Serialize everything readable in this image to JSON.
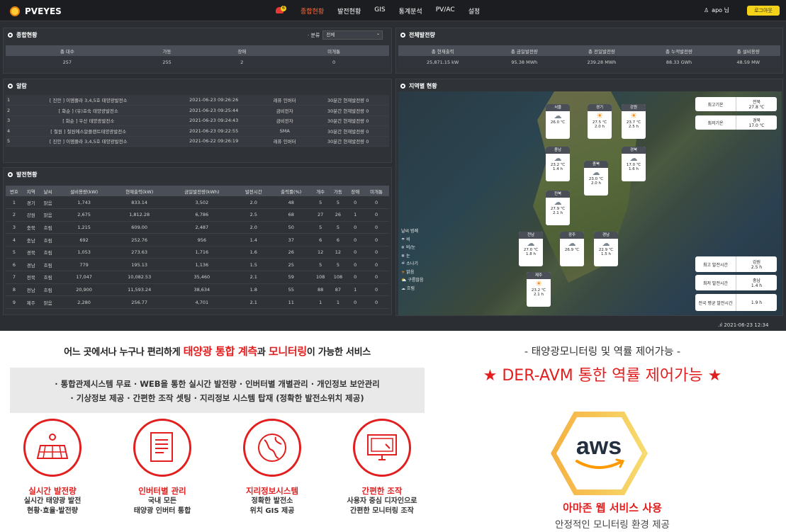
{
  "app": {
    "title": "PVEYES",
    "bell_count": "6"
  },
  "nav": {
    "items": [
      "종합현황",
      "발전현황",
      "GIS",
      "통계분석",
      "PV/AC",
      "설정"
    ],
    "active": 0
  },
  "user": {
    "name": "apo 님",
    "logout_label": "로그아웃"
  },
  "summary": {
    "title": "종합현황",
    "filter_label": "· 분류",
    "filter_value": "전체",
    "headers": [
      "총 대수",
      "가동",
      "장애",
      "미개통"
    ],
    "values": [
      "257",
      "255",
      "2",
      "0"
    ]
  },
  "overall": {
    "title": "전체발전량",
    "headers": [
      "총 현재출력",
      "총 금일발전량",
      "총 전일발전량",
      "총 누적발전량",
      "총 설비용량"
    ],
    "values": [
      "25,871.15 kW",
      "95.38 MWh",
      "239.28 MWh",
      "88.33 GWh",
      "48.59 MW"
    ]
  },
  "alarm": {
    "title": "알람",
    "rows": [
      [
        "1",
        "[ 진안 ] 이엠플라 3,4,5호 태양광발전소",
        "2021-06-23 09:26:26",
        "레퓨 인버터",
        "30분간 현재발전량 0"
      ],
      [
        "2",
        "[ 화순 ] (유)효숙 태양광발전소",
        "2021-06-23 09:25:44",
        "금비전자",
        "30분간 현재발전량 0"
      ],
      [
        "3",
        "[ 화순 ] 우산 태양광발전소",
        "2021-06-23 09:24:43",
        "금비전자",
        "30분간 현재발전량 0"
      ],
      [
        "4",
        "[ 철원 ] 철원에스알플랜트태양광발전소",
        "2021-06-23 09:22:55",
        "SMA",
        "30분간 현재발전량 0"
      ],
      [
        "5",
        "[ 진안 ] 이엠플라 3,4,5호 태양광발전소",
        "2021-06-22 09:26:19",
        "레퓨 인버터",
        "30분간 현재발전량 0"
      ]
    ]
  },
  "generation": {
    "title": "발전현황",
    "headers": [
      "번호",
      "지역",
      "날씨",
      "설비용량(kW)",
      "현재출력(kW)",
      "금일발전량(kWh)",
      "발전시간",
      "출력률(%)",
      "개수",
      "가동",
      "장애",
      "미개통"
    ],
    "rows": [
      [
        "1",
        "경기",
        "맑음",
        "1,743",
        "833.14",
        "3,502",
        "2.0",
        "48",
        "5",
        "5",
        "0",
        "0"
      ],
      [
        "2",
        "강원",
        "맑음",
        "2,675",
        "1,812.28",
        "6,786",
        "2.5",
        "68",
        "27",
        "26",
        "1",
        "0"
      ],
      [
        "3",
        "충북",
        "흐림",
        "1,215",
        "609.00",
        "2,487",
        "2.0",
        "50",
        "5",
        "5",
        "0",
        "0"
      ],
      [
        "4",
        "충남",
        "흐림",
        "692",
        "252.76",
        "956",
        "1.4",
        "37",
        "6",
        "6",
        "0",
        "0"
      ],
      [
        "5",
        "경북",
        "흐림",
        "1,053",
        "273.63",
        "1,716",
        "1.6",
        "26",
        "12",
        "12",
        "0",
        "0"
      ],
      [
        "6",
        "경남",
        "흐림",
        "779",
        "195.13",
        "1,136",
        "1.5",
        "25",
        "5",
        "5",
        "0",
        "0"
      ],
      [
        "7",
        "전북",
        "흐림",
        "17,047",
        "10,082.53",
        "35,460",
        "2.1",
        "59",
        "108",
        "108",
        "0",
        "0"
      ],
      [
        "8",
        "전남",
        "흐림",
        "20,900",
        "11,593.24",
        "38,634",
        "1.8",
        "55",
        "88",
        "87",
        "1",
        "0"
      ],
      [
        "9",
        "제주",
        "맑음",
        "2,280",
        "256.77",
        "4,701",
        "2.1",
        "11",
        "1",
        "1",
        "0",
        "0"
      ]
    ]
  },
  "region_map": {
    "title": "지역별 현황",
    "cards": [
      {
        "name": "서울",
        "temp": "26.0 ℃",
        "hours": "",
        "weather": "cloud"
      },
      {
        "name": "경기",
        "temp": "27.5 ℃",
        "hours": "2.0 h",
        "weather": "sun"
      },
      {
        "name": "강원",
        "temp": "23.7 ℃",
        "hours": "2.5 h",
        "weather": "sun"
      },
      {
        "name": "충남",
        "temp": "23.2 ℃",
        "hours": "1.4 h",
        "weather": "cloud"
      },
      {
        "name": "충북",
        "temp": "23.0 ℃",
        "hours": "2.0 h",
        "weather": "cloud"
      },
      {
        "name": "경북",
        "temp": "17.0 ℃",
        "hours": "1.6 h",
        "weather": "cloud"
      },
      {
        "name": "전북",
        "temp": "27.9 ℃",
        "hours": "2.1 h",
        "weather": "cloud"
      },
      {
        "name": "전남",
        "temp": "27.0 ℃",
        "hours": "1.8 h",
        "weather": "cloud"
      },
      {
        "name": "광주",
        "temp": "26.9 ℃",
        "hours": "",
        "weather": "cloud"
      },
      {
        "name": "경남",
        "temp": "22.9 ℃",
        "hours": "1.5 h",
        "weather": "cloud"
      },
      {
        "name": "제주",
        "temp": "23.2 ℃",
        "hours": "2.1 h",
        "weather": "sun"
      }
    ],
    "max_temp": {
      "label": "최고기온",
      "region": "전북",
      "value": "27.8 ℃"
    },
    "min_temp": {
      "label": "최저기온",
      "region": "경북",
      "value": "17.0 ℃"
    },
    "max_hours": {
      "label": "최고 발전시간",
      "region": "강원",
      "value": "2.5 h"
    },
    "min_hours": {
      "label": "최저 발전시간",
      "region": "충남",
      "value": "1.4 h"
    },
    "avg_hours": {
      "label": "전국 평균 발전시간",
      "value": "1.9 h"
    },
    "legend_title": "날씨 범례",
    "legend": [
      "비",
      "비/눈",
      "눈",
      "소나기",
      "맑음",
      "구름많음",
      "흐림"
    ]
  },
  "status": {
    "datetime": "2021-06-23   12:34"
  },
  "promo": {
    "headline_pre": "어느 곳에서나 누구나 편리하게 ",
    "headline_red1": "태양광 통합 계측",
    "headline_mid": "과 ",
    "headline_red2": "모니터링",
    "headline_post": "이 가능한 서비스",
    "features_line1": "· 통합관제시스템 무료   · WEB을 통한 실시간 발전량   · 인버터별 개별관리  · 개인정보 보안관리",
    "features_line2": "· 기상정보 제공   · 간편한 조작 셋팅   · 지리정보 시스템 탑재 (정확한 발전소위치 제공)",
    "items": [
      {
        "title": "실시간 발전량",
        "desc1": "실시간 태양광 발전",
        "desc2": "현황·효율·발전량"
      },
      {
        "title": "인버터별 관리",
        "desc1": "국내 모든",
        "desc2": "태양광 인버터 통합"
      },
      {
        "title": "지리정보시스템",
        "desc1": "정확한 발전소",
        "desc2": "위치 GIS 제공"
      },
      {
        "title": "간편한 조작",
        "desc1": "사용자 중심 디자인으로",
        "desc2": "간편한 모니터링 조작"
      }
    ],
    "right_sub": "- 태양광모니터링 및 역률 제어가능 -",
    "right_main": "★ DER-AVM  통한 역률 제어가능 ★",
    "aws_logo": "aws",
    "aws_title": "아마존 웹 서비스 사용",
    "aws_desc": "안정적인 모니터링 환경 제공"
  }
}
